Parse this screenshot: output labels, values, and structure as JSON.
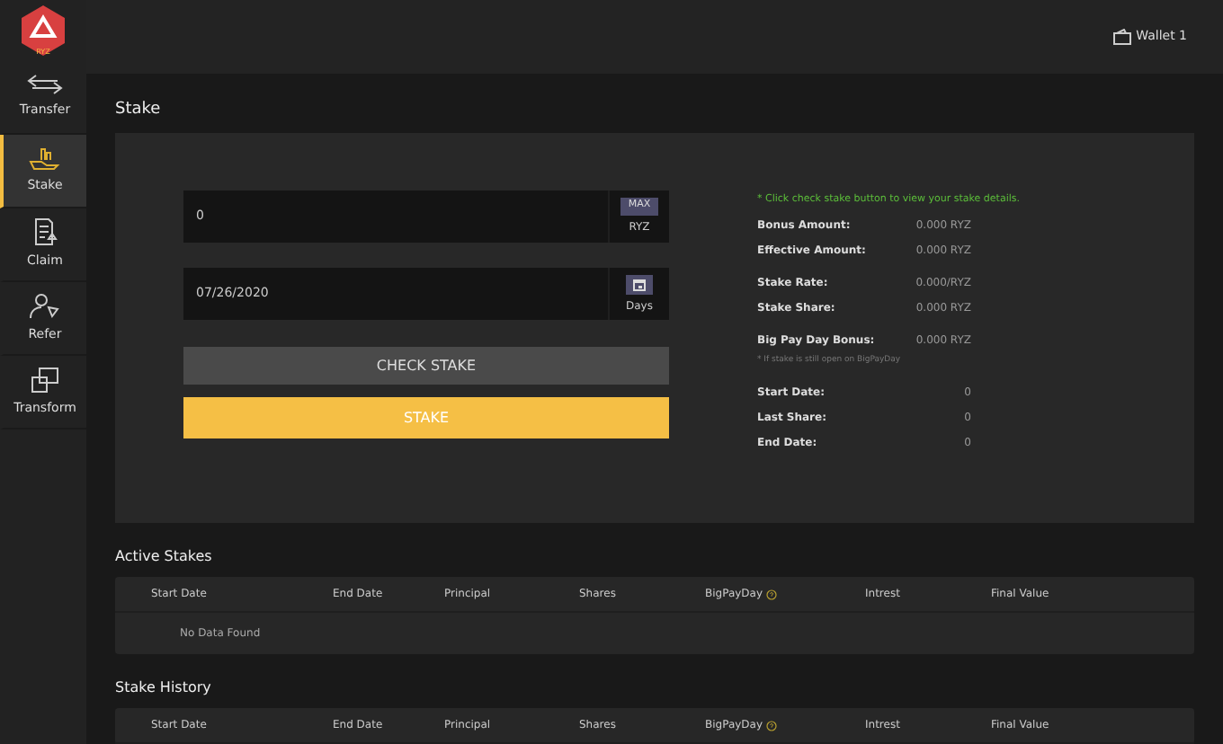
{
  "logo": {
    "text": "RYZ"
  },
  "sidebar": {
    "items": [
      {
        "label": "Transfer",
        "selected": false
      },
      {
        "label": "Stake",
        "selected": true
      },
      {
        "label": "Claim",
        "selected": false
      },
      {
        "label": "Refer",
        "selected": false
      },
      {
        "label": "Transform",
        "selected": false
      }
    ]
  },
  "header": {
    "wallet": "Wallet 1"
  },
  "page_title": "Stake",
  "stake_form": {
    "amount": {
      "value": "0",
      "max_button": "MAX",
      "unit": "RYZ"
    },
    "date": {
      "value": "07/26/2020",
      "unit": "Days"
    },
    "check_button": "CHECK STAKE",
    "stake_button": "STAKE"
  },
  "details": {
    "hint": "* Click check stake button to view your stake details.",
    "groups": [
      {
        "rows": [
          {
            "label": "Bonus Amount:",
            "value": "0.000 RYZ"
          },
          {
            "label": "Effective Amount:",
            "value": "0.000 RYZ"
          }
        ]
      },
      {
        "rows": [
          {
            "label": "Stake Rate:",
            "value": "0.000/RYZ"
          },
          {
            "label": "Stake Share:",
            "value": "0.000 RYZ"
          }
        ]
      },
      {
        "rows": [
          {
            "label": "Big Pay Day Bonus:",
            "value": "0.000 RYZ"
          }
        ],
        "note": "* If stake is still open on BigPayDay"
      },
      {
        "rows": [
          {
            "label": "Start Date:",
            "value": "0"
          },
          {
            "label": "Last Share:",
            "value": "0"
          },
          {
            "label": "End Date:",
            "value": "0"
          }
        ]
      }
    ]
  },
  "tables": [
    {
      "title": "Active Stakes",
      "columns": [
        {
          "label": "Start Date",
          "help": false
        },
        {
          "label": "End Date",
          "help": false
        },
        {
          "label": "Principal",
          "help": false
        },
        {
          "label": "Shares",
          "help": false
        },
        {
          "label": "BigPayDay",
          "help": true
        },
        {
          "label": "Intrest",
          "help": false
        },
        {
          "label": "Final Value",
          "help": false
        }
      ],
      "empty_text": "No Data Found"
    },
    {
      "title": "Stake History",
      "columns": [
        {
          "label": "Start Date",
          "help": false
        },
        {
          "label": "End Date",
          "help": false
        },
        {
          "label": "Principal",
          "help": false
        },
        {
          "label": "Shares",
          "help": false
        },
        {
          "label": "BigPayDay",
          "help": true
        },
        {
          "label": "Intrest",
          "help": false
        },
        {
          "label": "Final Value",
          "help": false
        }
      ]
    }
  ]
}
